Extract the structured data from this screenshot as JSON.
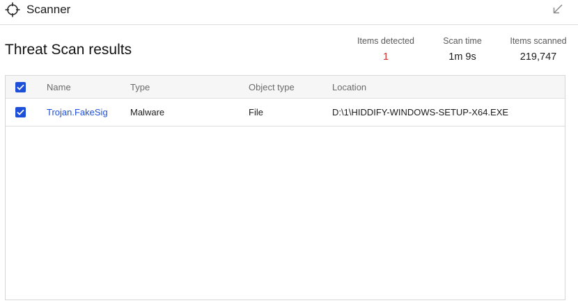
{
  "window": {
    "title": "Scanner",
    "icon": "crosshair-icon",
    "minimize_icon": "minimize-arrow-icon"
  },
  "page": {
    "title": "Threat Scan results"
  },
  "stats": {
    "items_detected_label": "Items detected",
    "items_detected_value": "1",
    "scan_time_label": "Scan time",
    "scan_time_value": "1m 9s",
    "items_scanned_label": "Items scanned",
    "items_scanned_value": "219,747"
  },
  "table": {
    "headers": {
      "name": "Name",
      "type": "Type",
      "object_type": "Object type",
      "location": "Location"
    },
    "select_all_checked": true,
    "rows": [
      {
        "checked": true,
        "name": "Trojan.FakeSig",
        "type": "Malware",
        "object_type": "File",
        "location": "D:\\1\\HIDDIFY-WINDOWS-SETUP-X64.EXE"
      }
    ]
  },
  "colors": {
    "accent": "#1e4fd8",
    "detected": "#d0312d"
  }
}
